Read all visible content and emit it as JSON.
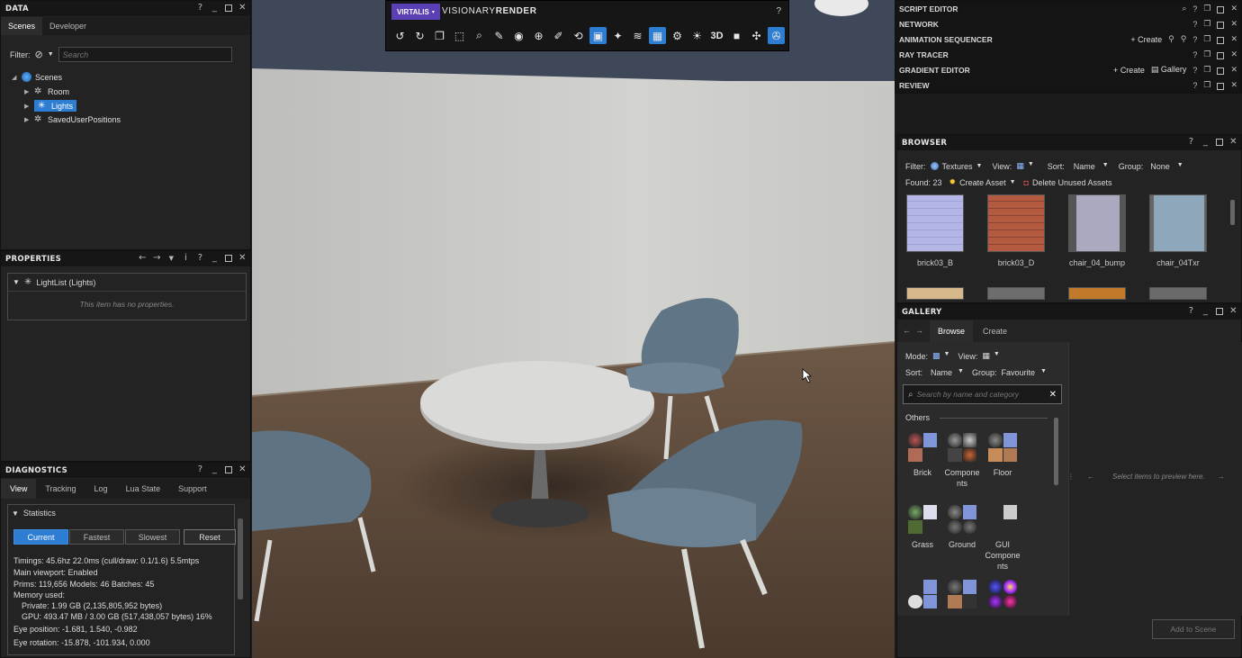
{
  "toolbar": {
    "brand": "VIRTALIS",
    "title_light": "VISIONARY",
    "title_bold": "RENDER",
    "help": "?",
    "three_d": "3D"
  },
  "data_panel": {
    "title": "DATA",
    "tabs": [
      "Scenes",
      "Developer"
    ],
    "filter_label": "Filter:",
    "search_placeholder": "Search",
    "tree": [
      {
        "label": "Scenes"
      },
      {
        "label": "Room"
      },
      {
        "label": "Lights"
      },
      {
        "label": "SavedUserPositions"
      }
    ]
  },
  "properties_panel": {
    "title": "PROPERTIES",
    "item": "LightList (Lights)",
    "empty": "This item has no properties."
  },
  "diagnostics_panel": {
    "title": "DIAGNOSTICS",
    "tabs": [
      "View",
      "Tracking",
      "Log",
      "Lua State",
      "Support"
    ],
    "section": "Statistics",
    "buttons": [
      "Current",
      "Fastest",
      "Slowest",
      "Reset"
    ],
    "lines": [
      "Timings: 45.6hz  22.0ms (cull/draw: 0.1/1.6)  5.5mtps",
      "Main viewport: Enabled",
      "Prims: 119,656  Models: 46  Batches: 45",
      "Memory used:",
      "    Private: 1.99 GB (2,135,805,952 bytes)",
      "    GPU: 493.47 MB / 3.00 GB (517,438,057 bytes) 16%",
      "Eye position: -1.681, 1.540, -0.982",
      "Eye rotation: -15.878, -101.934, 0.000"
    ]
  },
  "right_stack": [
    {
      "title": "SCRIPT EDITOR",
      "extras": []
    },
    {
      "title": "NETWORK",
      "extras": []
    },
    {
      "title": "ANIMATION SEQUENCER",
      "extras": [
        "Create"
      ]
    },
    {
      "title": "RAY TRACER",
      "extras": []
    },
    {
      "title": "GRADIENT EDITOR",
      "extras": [
        "Create",
        "Gallery"
      ]
    },
    {
      "title": "REVIEW",
      "extras": []
    }
  ],
  "browser_panel": {
    "title": "BROWSER",
    "filter_label": "Filter:",
    "filter_value": "Textures",
    "view_label": "View:",
    "sort_label": "Sort:",
    "sort_value": "Name",
    "group_label": "Group:",
    "group_value": "None",
    "found": "Found: 23",
    "create_asset": "Create Asset",
    "delete_unused": "Delete Unused Assets",
    "textures": [
      {
        "label": "brick03_B",
        "color": "#b7b9e8"
      },
      {
        "label": "brick03_D",
        "color": "#b0583f"
      },
      {
        "label": "chair_04_bump",
        "color": "#a8a8bf"
      },
      {
        "label": "chair_04Txr",
        "color": "#8fa7bb"
      }
    ]
  },
  "gallery_panel": {
    "title": "GALLERY",
    "tabs": [
      "Browse",
      "Create"
    ],
    "mode_label": "Mode:",
    "view_label": "View:",
    "sort_label": "Sort:",
    "sort_value": "Name",
    "group_label": "Group:",
    "group_value": "Favourite",
    "search_placeholder": "Search by name and category",
    "section": "Others",
    "items": [
      {
        "label": "Brick"
      },
      {
        "label": "Compone nts"
      },
      {
        "label": "Floor"
      },
      {
        "label": "Grass"
      },
      {
        "label": "Ground"
      },
      {
        "label": "GUI Compone nts"
      }
    ],
    "preview_hint": "Select items to preview here.",
    "add_button": "Add to Scene"
  }
}
